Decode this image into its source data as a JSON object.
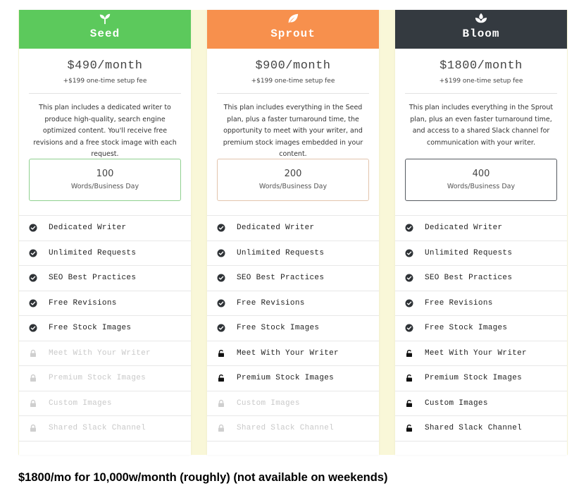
{
  "plans": [
    {
      "name": "Seed",
      "icon": "seedling-icon",
      "header_color": "#5cc95c",
      "box_border_color": "#8fd08f",
      "price": "$490/month",
      "setup_fee": "+$199 one-time setup fee",
      "description": "This plan includes a dedicated writer to produce high-quality, search engine optimized content. You'll receive free revisions and a free stock image with each request.",
      "words": "100",
      "words_label": "Words/Business Day",
      "features": [
        {
          "label": "Dedicated Writer",
          "state": "included"
        },
        {
          "label": "Unlimited Requests",
          "state": "included"
        },
        {
          "label": "SEO Best Practices",
          "state": "included"
        },
        {
          "label": "Free Revisions",
          "state": "included"
        },
        {
          "label": "Free Stock Images",
          "state": "included"
        },
        {
          "label": "Meet With Your Writer",
          "state": "locked"
        },
        {
          "label": "Premium Stock Images",
          "state": "locked"
        },
        {
          "label": "Custom Images",
          "state": "locked"
        },
        {
          "label": "Shared Slack Channel",
          "state": "locked"
        }
      ]
    },
    {
      "name": "Sprout",
      "icon": "leaf-icon",
      "header_color": "#f7904d",
      "box_border_color": "#e2c4ad",
      "price": "$900/month",
      "setup_fee": "+$199 one-time setup fee",
      "description": "This plan includes everything in the Seed plan, plus a faster turnaround time, the opportunity to meet with your writer, and premium stock images embedded in your content.",
      "words": "200",
      "words_label": "Words/Business Day",
      "features": [
        {
          "label": "Dedicated Writer",
          "state": "included"
        },
        {
          "label": "Unlimited Requests",
          "state": "included"
        },
        {
          "label": "SEO Best Practices",
          "state": "included"
        },
        {
          "label": "Free Revisions",
          "state": "included"
        },
        {
          "label": "Free Stock Images",
          "state": "included"
        },
        {
          "label": "Meet With Your Writer",
          "state": "unlocked"
        },
        {
          "label": "Premium Stock Images",
          "state": "unlocked"
        },
        {
          "label": "Custom Images",
          "state": "locked"
        },
        {
          "label": "Shared Slack Channel",
          "state": "locked"
        }
      ]
    },
    {
      "name": "Bloom",
      "icon": "lotus-icon",
      "header_color": "#343a40",
      "box_border_color": "#555a60",
      "price": "$1800/month",
      "setup_fee": "+$199 one-time setup fee",
      "description": "This plan includes everything in the Sprout plan, plus an even faster turnaround time, and access to a shared Slack channel for communication with your writer.",
      "words": "400",
      "words_label": "Words/Business Day",
      "features": [
        {
          "label": "Dedicated Writer",
          "state": "included"
        },
        {
          "label": "Unlimited Requests",
          "state": "included"
        },
        {
          "label": "SEO Best Practices",
          "state": "included"
        },
        {
          "label": "Free Revisions",
          "state": "included"
        },
        {
          "label": "Free Stock Images",
          "state": "included"
        },
        {
          "label": "Meet With Your Writer",
          "state": "unlocked"
        },
        {
          "label": "Premium Stock Images",
          "state": "unlocked"
        },
        {
          "label": "Custom Images",
          "state": "unlocked"
        },
        {
          "label": "Shared Slack Channel",
          "state": "unlocked"
        }
      ]
    }
  ],
  "caption": "$1800/mo for 10,000w/month (roughly) (not available on weekends)"
}
